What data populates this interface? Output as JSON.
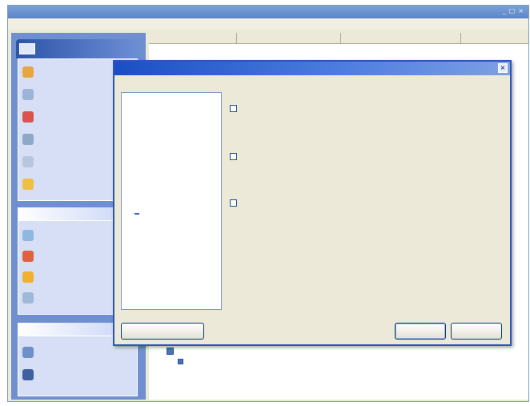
{
  "window": {
    "title": "",
    "menu": [
      "",
      "",
      "",
      ""
    ]
  },
  "list_columns": [
    "",
    "",
    "",
    ""
  ],
  "sidebar": {
    "header": "",
    "items": [
      "",
      "",
      "",
      "",
      "",
      ""
    ],
    "section2_title": "",
    "section2_items": [
      "",
      "",
      "",
      ""
    ],
    "section3_title": "",
    "section3_items": [
      "",
      ""
    ]
  },
  "tree": {
    "root": "",
    "child": ""
  },
  "dialog": {
    "title": "",
    "categories_label": "",
    "options_label": "",
    "categories": [
      "",
      "",
      "",
      "",
      "",
      "",
      "",
      "",
      "",
      "",
      "",
      "",
      "",
      "",
      ""
    ],
    "selected_category": "",
    "options": [
      {
        "title": "",
        "description": ""
      },
      {
        "title": "",
        "description": ""
      },
      {
        "title": "",
        "description": ""
      }
    ],
    "buttons": {
      "left": "",
      "ok": "",
      "cancel": ""
    }
  },
  "colors": {
    "window_bg": "#ece9d8",
    "dialog_title": "#1a4fc4",
    "sidebar_bg": "#6f8fd0",
    "selection": "#316ac5"
  },
  "icons": [
    "app-logo-icon",
    "task-icon",
    "folder-icon",
    "close-icon",
    "computer-icon"
  ]
}
